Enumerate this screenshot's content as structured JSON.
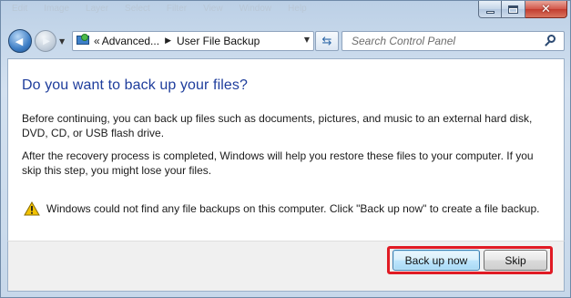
{
  "window": {
    "menu_items": [
      "Edit",
      "Image",
      "Layer",
      "Select",
      "Filter",
      "View",
      "Window",
      "Help"
    ],
    "minimize_glyph": "",
    "close_glyph": "✕"
  },
  "navbar": {
    "back_glyph": "◀",
    "forward_glyph": "▶",
    "dropdown_glyph": "▼",
    "breadcrumb_chevron": "«",
    "breadcrumb_parent": "Advanced...",
    "breadcrumb_separator": "▶",
    "breadcrumb_current": "User File Backup",
    "address_dropdown_glyph": "▼",
    "refresh_glyph": "⇆",
    "search_placeholder": "Search Control Panel"
  },
  "dialog": {
    "title": "Do you want to back up your files?",
    "paragraph1": "Before continuing, you can back up files such as documents, pictures, and music to an external hard disk, DVD, CD, or USB flash drive.",
    "paragraph2": "After the recovery process is completed, Windows will help you restore these files to  your computer.  If you skip this step, you might lose your files.",
    "warning": "Windows could not find any file backups on this computer. Click \"Back up now\" to create a file backup."
  },
  "buttons": {
    "backup_label": "Back up now",
    "skip_label": "Skip"
  },
  "colors": {
    "title_blue": "#1e3d9c",
    "highlight_red": "#e01b24",
    "warning_yellow": "#f2c200"
  },
  "icons": {
    "warning": "warning-triangle-icon",
    "search": "search-icon",
    "control_panel": "control-panel-icon"
  }
}
